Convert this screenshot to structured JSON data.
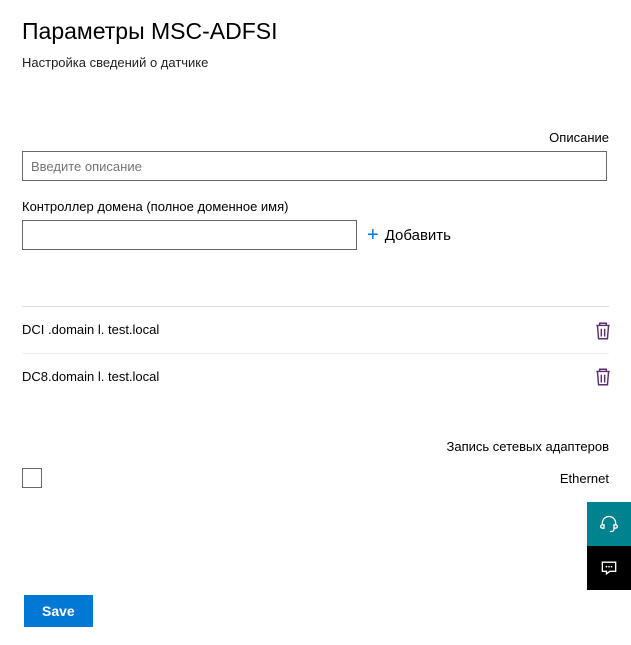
{
  "header": {
    "title": "Параметры MSC-ADFSI",
    "subtitle": "Настройка сведений о датчике"
  },
  "description": {
    "label": "Описание",
    "placeholder": "Введите описание",
    "value": ""
  },
  "domainController": {
    "label": "Контроллер домена (полное доменное имя)",
    "value": "",
    "addLabel": "Добавить"
  },
  "dcList": [
    {
      "name": "DCI .domain l. test.local"
    },
    {
      "name": "DC8.domain l. test.local"
    }
  ],
  "networkAdapters": {
    "label": "Запись сетевых адаптеров",
    "ethernetLabel": "Ethernet",
    "ethernetChecked": false
  },
  "actions": {
    "save": "Save"
  }
}
